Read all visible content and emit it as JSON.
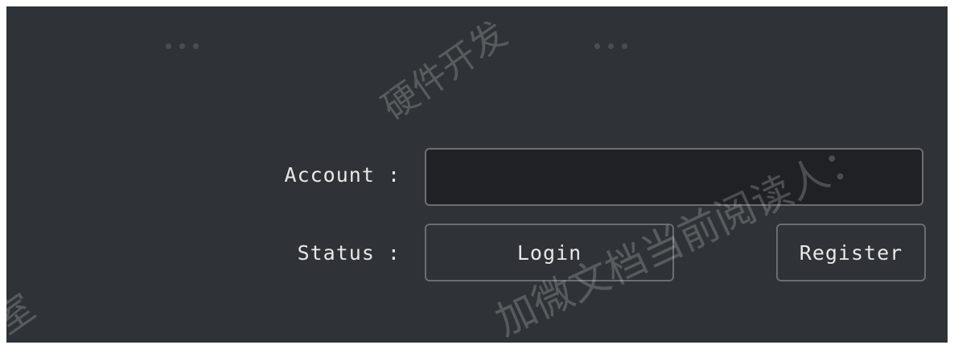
{
  "form": {
    "account_label": "Account :",
    "account_value": "",
    "status_label": "Status :",
    "login_button": "Login",
    "register_button": "Register"
  },
  "watermark": {
    "line1": "硬件开发",
    "line2": "加微文档当前阅读人：",
    "line3": "室"
  },
  "colors": {
    "panel_bg": "#2f3236",
    "input_bg": "#1f2125",
    "border": "#6a6e73",
    "text": "#e8e8e8"
  }
}
